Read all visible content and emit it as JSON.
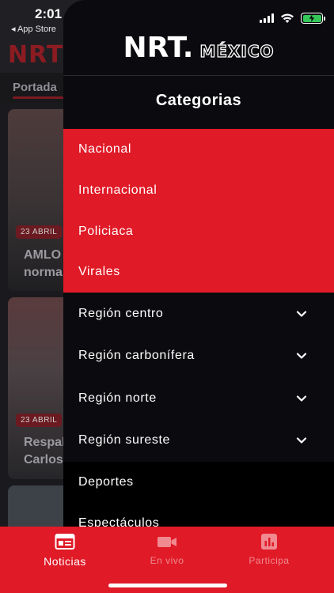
{
  "status_bar": {
    "time": "2:01",
    "back_label": "◂ App Store"
  },
  "background": {
    "logo": "NRT",
    "tab": "Portada",
    "cards": [
      {
        "date": "23 ABRIL",
        "title_line1": "AMLO",
        "title_line2": "norma"
      },
      {
        "date": "23 ABRIL",
        "title_line1": "Respal",
        "title_line2": "Carlos"
      }
    ]
  },
  "drawer": {
    "brand_primary": "NRT.",
    "brand_secondary": "MÉXICO",
    "title": "Categorias",
    "highlighted_items": [
      "Nacional",
      "Internacional",
      "Policiaca",
      "Virales"
    ],
    "region_items": [
      "Región centro",
      "Región carbonífera",
      "Región norte",
      "Región sureste"
    ],
    "bottom_items": [
      "Deportes",
      "Espectáculos"
    ]
  },
  "tabbar": {
    "tabs": [
      {
        "label": "Noticias",
        "icon": "newspaper-icon",
        "active": true
      },
      {
        "label": "En vivo",
        "icon": "video-camera-icon",
        "active": false
      },
      {
        "label": "Participa",
        "icon": "chart-icon",
        "active": false
      }
    ]
  },
  "colors": {
    "accent_red": "#e01a27",
    "drawer_bg": "#0b0b0f",
    "battery_green": "#34c759"
  }
}
